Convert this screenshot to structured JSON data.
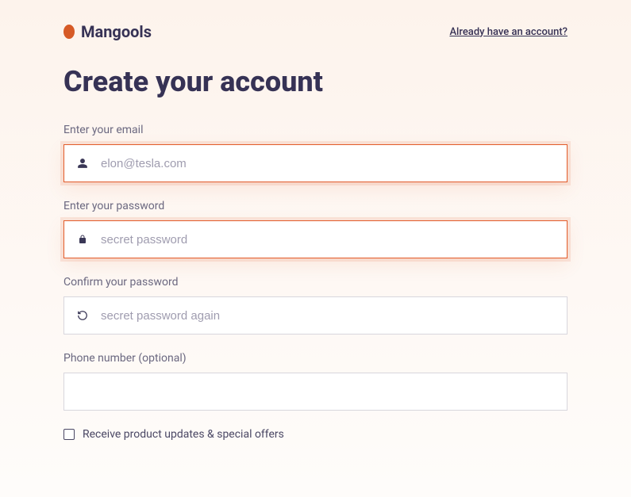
{
  "brand": {
    "name": "Mangools"
  },
  "header": {
    "signin_link": "Already have an account?"
  },
  "title": "Create your account",
  "fields": {
    "email": {
      "label": "Enter your email",
      "placeholder": "elon@tesla.com"
    },
    "password": {
      "label": "Enter your password",
      "placeholder": "secret password"
    },
    "confirm": {
      "label": "Confirm your password",
      "placeholder": "secret password again"
    },
    "phone": {
      "label": "Phone number (optional)",
      "placeholder": ""
    }
  },
  "checkbox": {
    "label": "Receive product updates & special offers"
  }
}
